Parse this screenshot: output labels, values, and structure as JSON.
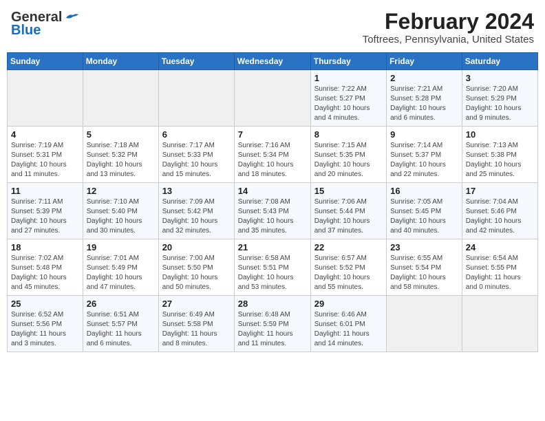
{
  "header": {
    "logo_line1": "General",
    "logo_line2": "Blue",
    "month_year": "February 2024",
    "location": "Toftrees, Pennsylvania, United States"
  },
  "days_of_week": [
    "Sunday",
    "Monday",
    "Tuesday",
    "Wednesday",
    "Thursday",
    "Friday",
    "Saturday"
  ],
  "weeks": [
    [
      {
        "day": "",
        "info": ""
      },
      {
        "day": "",
        "info": ""
      },
      {
        "day": "",
        "info": ""
      },
      {
        "day": "",
        "info": ""
      },
      {
        "day": "1",
        "info": "Sunrise: 7:22 AM\nSunset: 5:27 PM\nDaylight: 10 hours\nand 4 minutes."
      },
      {
        "day": "2",
        "info": "Sunrise: 7:21 AM\nSunset: 5:28 PM\nDaylight: 10 hours\nand 6 minutes."
      },
      {
        "day": "3",
        "info": "Sunrise: 7:20 AM\nSunset: 5:29 PM\nDaylight: 10 hours\nand 9 minutes."
      }
    ],
    [
      {
        "day": "4",
        "info": "Sunrise: 7:19 AM\nSunset: 5:31 PM\nDaylight: 10 hours\nand 11 minutes."
      },
      {
        "day": "5",
        "info": "Sunrise: 7:18 AM\nSunset: 5:32 PM\nDaylight: 10 hours\nand 13 minutes."
      },
      {
        "day": "6",
        "info": "Sunrise: 7:17 AM\nSunset: 5:33 PM\nDaylight: 10 hours\nand 15 minutes."
      },
      {
        "day": "7",
        "info": "Sunrise: 7:16 AM\nSunset: 5:34 PM\nDaylight: 10 hours\nand 18 minutes."
      },
      {
        "day": "8",
        "info": "Sunrise: 7:15 AM\nSunset: 5:35 PM\nDaylight: 10 hours\nand 20 minutes."
      },
      {
        "day": "9",
        "info": "Sunrise: 7:14 AM\nSunset: 5:37 PM\nDaylight: 10 hours\nand 22 minutes."
      },
      {
        "day": "10",
        "info": "Sunrise: 7:13 AM\nSunset: 5:38 PM\nDaylight: 10 hours\nand 25 minutes."
      }
    ],
    [
      {
        "day": "11",
        "info": "Sunrise: 7:11 AM\nSunset: 5:39 PM\nDaylight: 10 hours\nand 27 minutes."
      },
      {
        "day": "12",
        "info": "Sunrise: 7:10 AM\nSunset: 5:40 PM\nDaylight: 10 hours\nand 30 minutes."
      },
      {
        "day": "13",
        "info": "Sunrise: 7:09 AM\nSunset: 5:42 PM\nDaylight: 10 hours\nand 32 minutes."
      },
      {
        "day": "14",
        "info": "Sunrise: 7:08 AM\nSunset: 5:43 PM\nDaylight: 10 hours\nand 35 minutes."
      },
      {
        "day": "15",
        "info": "Sunrise: 7:06 AM\nSunset: 5:44 PM\nDaylight: 10 hours\nand 37 minutes."
      },
      {
        "day": "16",
        "info": "Sunrise: 7:05 AM\nSunset: 5:45 PM\nDaylight: 10 hours\nand 40 minutes."
      },
      {
        "day": "17",
        "info": "Sunrise: 7:04 AM\nSunset: 5:46 PM\nDaylight: 10 hours\nand 42 minutes."
      }
    ],
    [
      {
        "day": "18",
        "info": "Sunrise: 7:02 AM\nSunset: 5:48 PM\nDaylight: 10 hours\nand 45 minutes."
      },
      {
        "day": "19",
        "info": "Sunrise: 7:01 AM\nSunset: 5:49 PM\nDaylight: 10 hours\nand 47 minutes."
      },
      {
        "day": "20",
        "info": "Sunrise: 7:00 AM\nSunset: 5:50 PM\nDaylight: 10 hours\nand 50 minutes."
      },
      {
        "day": "21",
        "info": "Sunrise: 6:58 AM\nSunset: 5:51 PM\nDaylight: 10 hours\nand 53 minutes."
      },
      {
        "day": "22",
        "info": "Sunrise: 6:57 AM\nSunset: 5:52 PM\nDaylight: 10 hours\nand 55 minutes."
      },
      {
        "day": "23",
        "info": "Sunrise: 6:55 AM\nSunset: 5:54 PM\nDaylight: 10 hours\nand 58 minutes."
      },
      {
        "day": "24",
        "info": "Sunrise: 6:54 AM\nSunset: 5:55 PM\nDaylight: 11 hours\nand 0 minutes."
      }
    ],
    [
      {
        "day": "25",
        "info": "Sunrise: 6:52 AM\nSunset: 5:56 PM\nDaylight: 11 hours\nand 3 minutes."
      },
      {
        "day": "26",
        "info": "Sunrise: 6:51 AM\nSunset: 5:57 PM\nDaylight: 11 hours\nand 6 minutes."
      },
      {
        "day": "27",
        "info": "Sunrise: 6:49 AM\nSunset: 5:58 PM\nDaylight: 11 hours\nand 8 minutes."
      },
      {
        "day": "28",
        "info": "Sunrise: 6:48 AM\nSunset: 5:59 PM\nDaylight: 11 hours\nand 11 minutes."
      },
      {
        "day": "29",
        "info": "Sunrise: 6:46 AM\nSunset: 6:01 PM\nDaylight: 11 hours\nand 14 minutes."
      },
      {
        "day": "",
        "info": ""
      },
      {
        "day": "",
        "info": ""
      }
    ]
  ]
}
